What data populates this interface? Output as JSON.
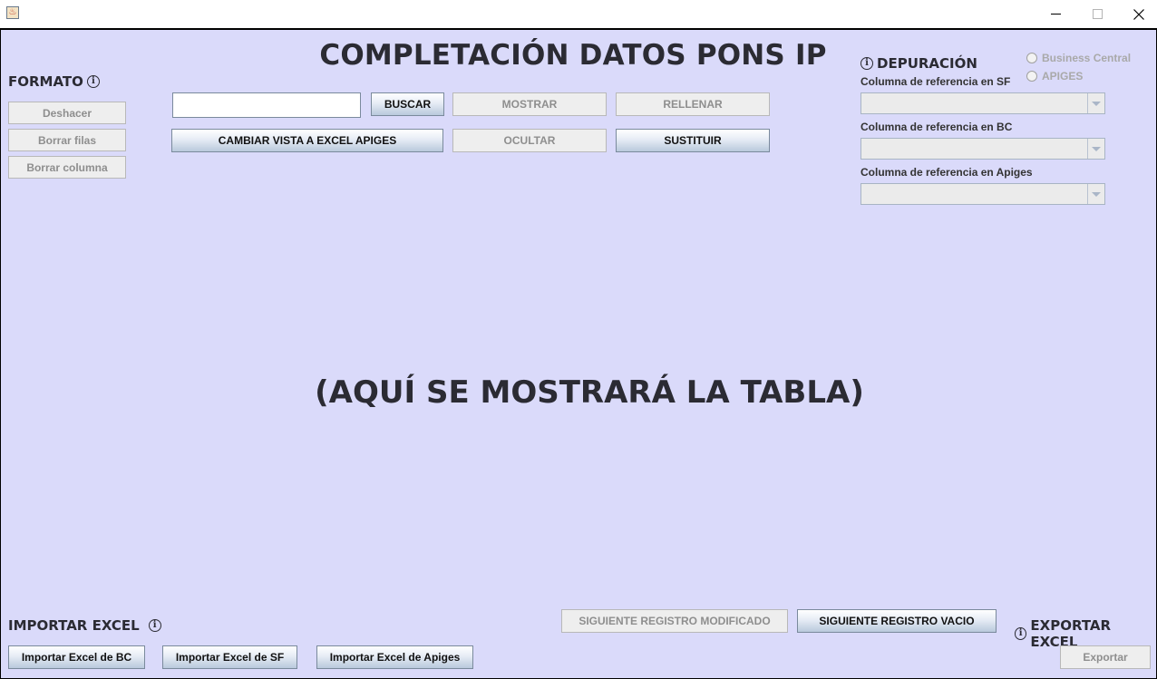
{
  "window": {
    "icon": "java-cup-icon",
    "controls": {
      "minimize": "—",
      "maximize": "☐",
      "close": "✕"
    }
  },
  "header": {
    "title": "COMPLETACIÓN DATOS PONS IP"
  },
  "format": {
    "label": "FORMATO",
    "undo": "Deshacer",
    "delete_rows": "Borrar filas",
    "delete_column": "Borrar columna"
  },
  "search": {
    "value": "",
    "placeholder": "",
    "search_btn": "BUSCAR",
    "show_btn": "MOSTRAR",
    "fill_btn": "RELLENAR",
    "change_view_btn": "CAMBIAR VISTA A EXCEL APIGES",
    "hide_btn": "OCULTAR",
    "replace_btn": "SUSTITUIR"
  },
  "depuracion": {
    "label": "DEPURACIÓN",
    "radio_bc": "Business Central",
    "radio_apiges": "APIGES",
    "sf_label": "Columna de referencia en SF",
    "bc_label": "Columna de referencia en BC",
    "apiges_label": "Columna de referencia en Apiges"
  },
  "table_placeholder": "(AQUÍ SE MOSTRARÁ LA TABLA)",
  "navigation": {
    "next_modified": "SIGUIENTE REGISTRO MODIFICADO",
    "next_empty": "SIGUIENTE REGISTRO VACIO"
  },
  "import": {
    "label": "IMPORTAR EXCEL",
    "bc": "Importar Excel de BC",
    "sf": "Importar Excel de SF",
    "apiges": "Importar Excel de Apiges"
  },
  "export": {
    "label": "EXPORTAR EXCEL",
    "btn": "Exportar"
  },
  "colors": {
    "background": "#dadafa",
    "text": "#2b2b33",
    "disabled_text": "#8e8e8e"
  }
}
